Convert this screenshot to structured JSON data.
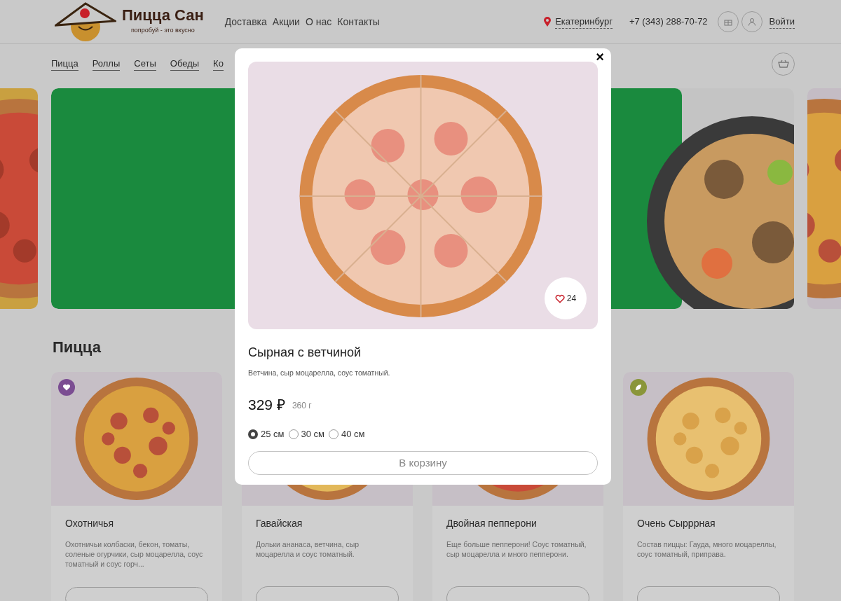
{
  "header": {
    "brand": "Пицца Сан",
    "tagline": "попробуй - это вкусно",
    "nav": [
      "Доставка",
      "Акции",
      "О нас",
      "Контакты"
    ],
    "city": "Екатеринбург",
    "phone": "+7 (343) 288-70-72",
    "login": "Войти"
  },
  "categories": [
    "Пицца",
    "Роллы",
    "Сеты",
    "Обеды",
    "Ко"
  ],
  "section_title": "Пицца",
  "products": [
    {
      "name": "Охотничья",
      "description": "Охотничьи колбаски, бекон, томаты, соленые огурчики, сыр моцарелла, соус томатный и соус горч...",
      "badge": {
        "kind": "heart",
        "color": "#7b4d92"
      }
    },
    {
      "name": "Гавайская",
      "description": "Дольки ананаса, ветчина, сыр моцарелла и соус томатный."
    },
    {
      "name": "Двойная пепперони",
      "description": "Еще больше пепперони! Соус томатный, сыр моцарелла и много пепперони."
    },
    {
      "name": "Очень Сырррная",
      "description": "Состав пиццы: Гауда, много моцареллы, соус томатный, приправа.",
      "badge": {
        "kind": "leaf",
        "color": "#8a963a"
      }
    }
  ],
  "modal": {
    "title": "Сырная с ветчиной",
    "description": "Ветчина, сыр моцарелла, соус томатный.",
    "price": "329 ₽",
    "weight": "360 г",
    "likes": "24",
    "close": "×",
    "sizes": [
      {
        "label": "25 см",
        "selected": true
      },
      {
        "label": "30 см",
        "selected": false
      },
      {
        "label": "40 см",
        "selected": false
      }
    ],
    "button": "В корзину"
  }
}
